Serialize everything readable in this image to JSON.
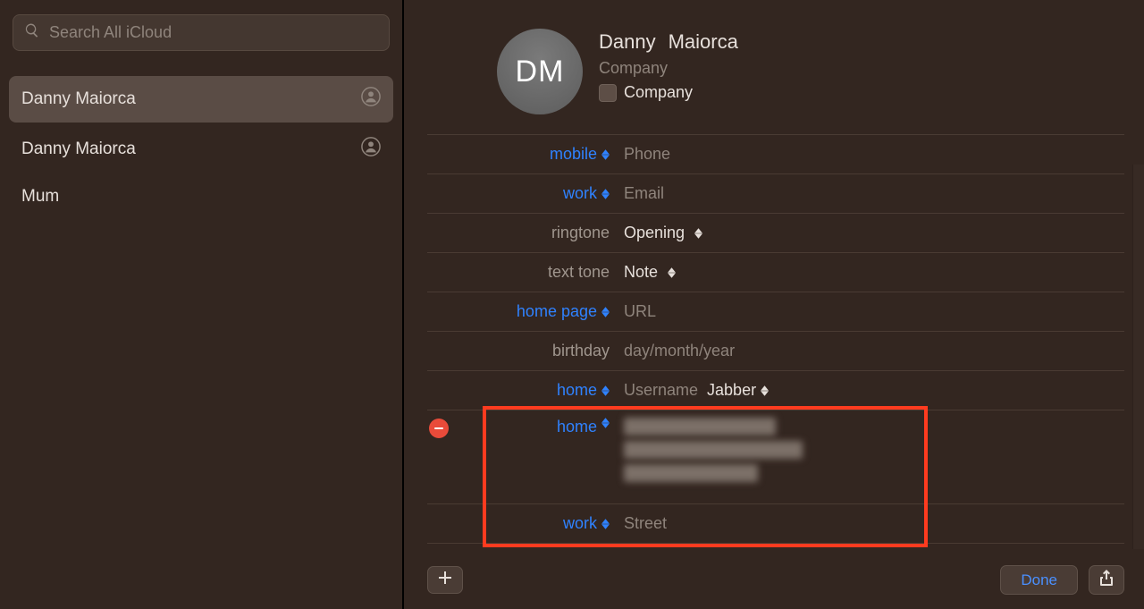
{
  "sidebar": {
    "search_placeholder": "Search All iCloud",
    "items": [
      {
        "name": "Danny  Maiorca",
        "me": true,
        "selected": true
      },
      {
        "name": "Danny Maiorca",
        "me": true,
        "selected": false
      },
      {
        "name": "Mum",
        "me": false,
        "selected": false
      }
    ]
  },
  "contact": {
    "initials": "DM",
    "first_name": "Danny",
    "last_name": "Maiorca",
    "company_placeholder": "Company",
    "company_checkbox_label": "Company"
  },
  "fields": {
    "mobile": {
      "label": "mobile",
      "value_placeholder": "Phone"
    },
    "work_email": {
      "label": "work",
      "value_placeholder": "Email"
    },
    "ringtone": {
      "label": "ringtone",
      "value": "Opening"
    },
    "texttone": {
      "label": "text tone",
      "value": "Note"
    },
    "homepage": {
      "label": "home page",
      "value_placeholder": "URL"
    },
    "birthday": {
      "label": "birthday",
      "value_placeholder": "day/month/year"
    },
    "username": {
      "label": "home",
      "value_placeholder": "Username",
      "service": "Jabber"
    },
    "address_home": {
      "label": "home"
    },
    "address_work": {
      "label": "work",
      "value_placeholder": "Street"
    }
  },
  "footer": {
    "done_label": "Done"
  }
}
